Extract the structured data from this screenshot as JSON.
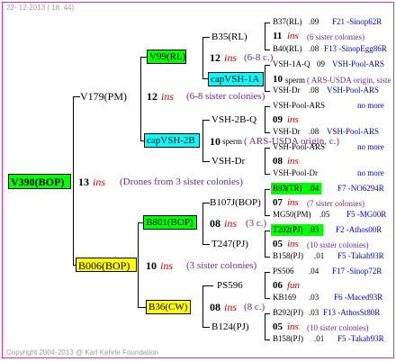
{
  "header": "22- 12-2013 ( 18: 44)",
  "footer": "Copyright 2004-2013 @ Karl Kehrle Foundation",
  "colors": {
    "green": "#00ff00",
    "cyan": "#00ffff",
    "yellow": "#ffff00",
    "red": "#cc0000",
    "purple": "#6a2a8a",
    "blue": "#0000cc"
  },
  "root": {
    "name": "V390(BOP)",
    "year": "13",
    "ins": "ins",
    "desc": "(Drones from 3 sister colonies)"
  },
  "g1a": {
    "name": "V179(PM)",
    "year": "12",
    "ins": "ins",
    "desc": "(6-8 sister colonies)"
  },
  "g1b": {
    "name": "B006(BOP)",
    "year": "10",
    "ins": "ins",
    "desc": "(3 sister colonies)"
  },
  "g2": {
    "v99": {
      "name": "V99(RL)",
      "year": "12",
      "ins": "ins",
      "desc": "(6-8 c.)"
    },
    "capvsh2b": {
      "name": "capVSH-2B",
      "year": "10",
      "ins": "sperm",
      "desc": "( ARS-USDA origin, c.)"
    },
    "b801": {
      "name": "B801(BOP)",
      "year": "08",
      "ins": "ins",
      "desc": "(3 c.)"
    },
    "b36": {
      "name": "B36(CW)",
      "year": "08",
      "ins": "ins",
      "desc": "(8 c.)"
    }
  },
  "g3": {
    "b35": {
      "name": "B35(RL)"
    },
    "capvsh1a": {
      "name": "capVSH-1A",
      "year": "10",
      "ins": "sperm",
      "desc": "( ARS-USDA origin, siste"
    },
    "vsh2bq": {
      "name": "VSH-2B-Q",
      "year": "09",
      "ins": "ins"
    },
    "vshdr": {
      "name": "VSH-Dr",
      "year": "08",
      "ins": "ins"
    },
    "b107j": {
      "name": "B107J(BOP)",
      "year": "07",
      "ins": "ins",
      "desc": "(7 sister colonies)"
    },
    "t247": {
      "name": "T247(PJ)",
      "year": "05",
      "ins": "ins",
      "desc": "(10 sister colonies)"
    },
    "ps596": {
      "name": "PS596",
      "year": "06",
      "ins": "fun"
    },
    "b124": {
      "name": "B124(PJ)",
      "year": "05",
      "ins": "ins",
      "desc": "(10 sister colonies)"
    }
  },
  "g4": {
    "b37": {
      "name": "B37(RL)",
      "year": ".09",
      "ref": "F21 -Sinop62R"
    },
    "b35mid": {
      "year": "11",
      "ins": "ins",
      "desc": "(6 sister colonies)"
    },
    "b40": {
      "name": "B40(RL)",
      "year": ".08",
      "ref": "F13 -SinopEgg86R"
    },
    "vsh1aq": {
      "name": "VSH-1A-Q",
      "year": "09",
      "ref": "VSH-Pool-ARS"
    },
    "vshdr1": {
      "name": "VSH-Dr",
      "year": ".08",
      "ref": "VSH-Pool-ARS"
    },
    "vshpool1": {
      "name": "VSH-Pool-ARS",
      "ref": "no more"
    },
    "vshdr2": {
      "name": "VSH-Dr",
      "year": ".08",
      "ref": "VSH-Pool-ARS"
    },
    "vshpool2": {
      "name": "VSH-Pool-ARS",
      "ref": "no more"
    },
    "vshpooldr": {
      "name": "VSH-Pool-Dr",
      "ref": "no more"
    },
    "b93": {
      "name": "B93(TR)",
      "year": ".04",
      "ref": "F7 -NO6294R"
    },
    "mg50": {
      "name": "MG50(PM)",
      "year": ".05",
      "ref": "F5 -MG00R"
    },
    "t202": {
      "name": "T202(PJ)",
      "year": ".03",
      "ref": "F2 -Athos00R"
    },
    "b158a": {
      "name": "B158(PJ)",
      "year": ".01",
      "ref": "F5 -Takab93R"
    },
    "ps506": {
      "name": "PS506",
      "year": ".04",
      "ref": "F17 -Sinop72R"
    },
    "kb169": {
      "name": "KB169",
      "year": ".03",
      "ref": "F6 -Maced93R"
    },
    "b292": {
      "name": "B292(PJ)",
      "year": ".03",
      "ref": "F13 -AthosSt80R"
    },
    "b158b": {
      "name": "B158(PJ)",
      "year": ".01",
      "ref": "F5 -Takab93R"
    }
  }
}
